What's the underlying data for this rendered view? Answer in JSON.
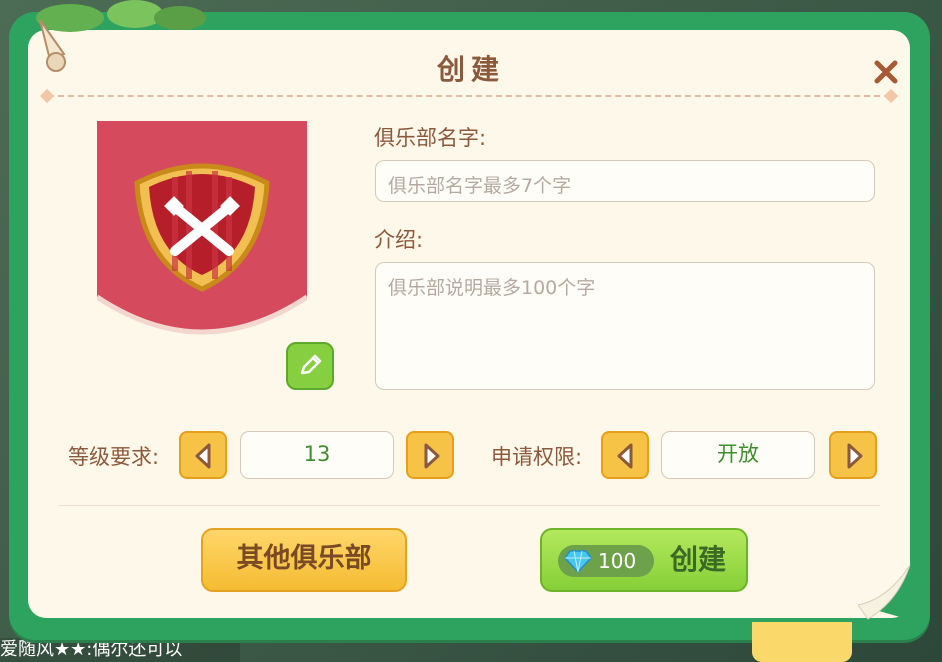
{
  "dialog": {
    "title": "创建",
    "close_icon": "close-icon"
  },
  "form": {
    "name_label": "俱乐部名字:",
    "name_placeholder": "俱乐部名字最多7个字",
    "intro_label": "介绍:",
    "intro_placeholder": "俱乐部说明最多100个字"
  },
  "settings": {
    "level_label": "等级要求:",
    "level_value": "13",
    "permission_label": "申请权限:",
    "permission_value": "开放"
  },
  "buttons": {
    "other_clubs": "其他俱乐部",
    "create_cost": "100",
    "create_label": "创建"
  },
  "background": {
    "ticker_text": "爱随风★★:偶尔还可以"
  },
  "colors": {
    "frame_green": "#2ea35f",
    "title_brown": "#8b5a3d",
    "emblem_red": "#d54b5d",
    "value_green": "#3f8d2e"
  }
}
